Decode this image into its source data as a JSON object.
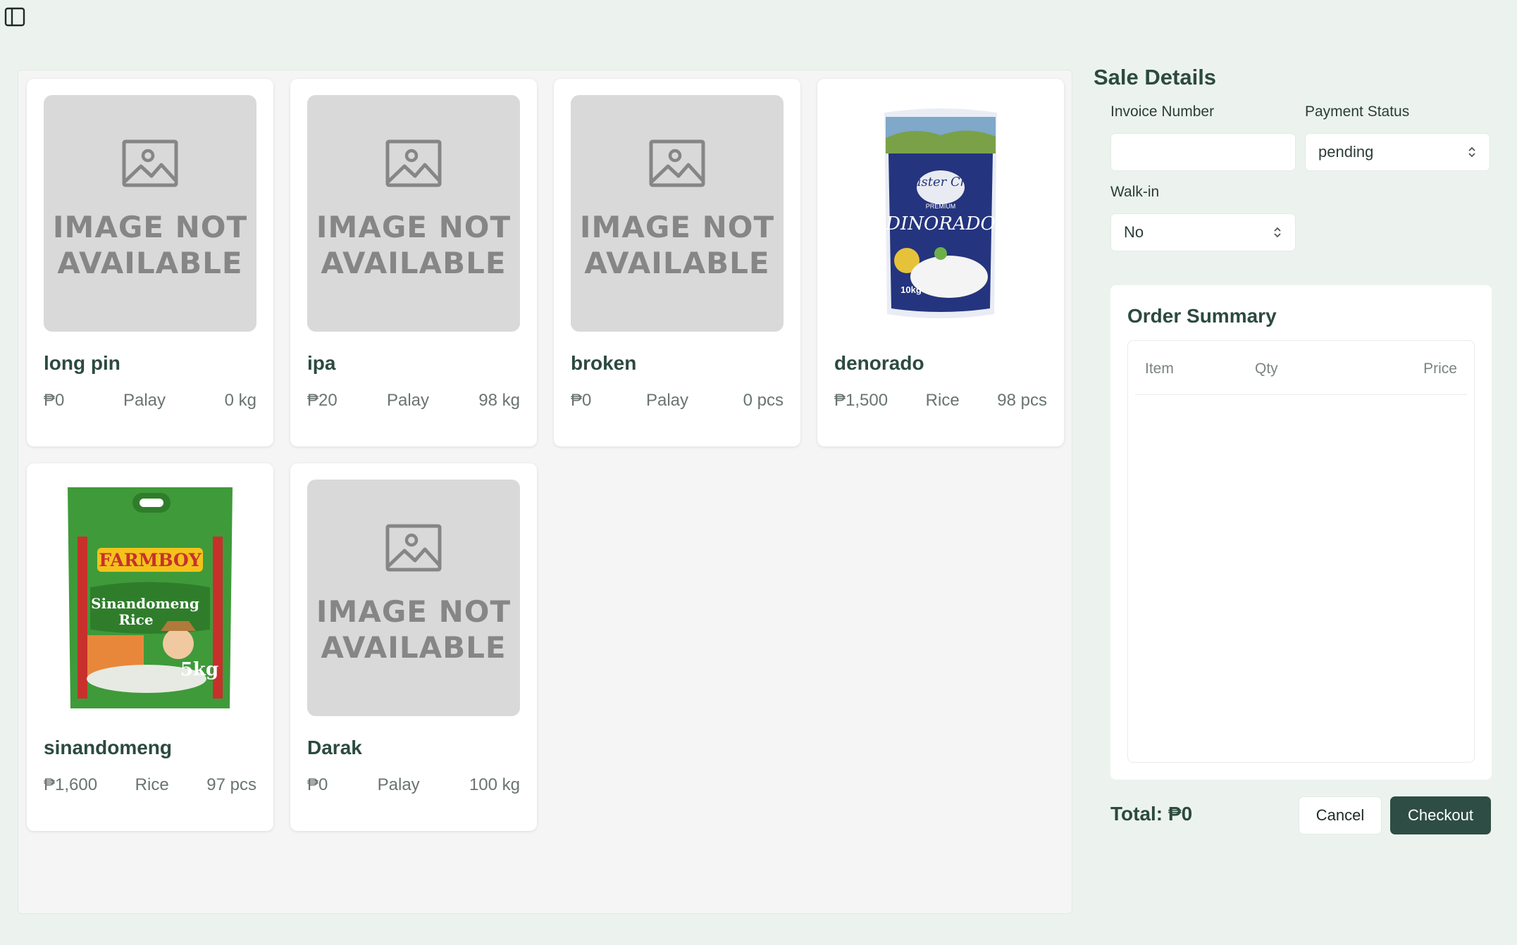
{
  "icons": {
    "sidebar_toggle": "sidebar-toggle-icon",
    "placeholder": "image-placeholder-icon",
    "select_chevrons": "chevron-up-down-icon"
  },
  "placeholder_text": "IMAGE NOT AVAILABLE",
  "products": [
    {
      "name": "long pin",
      "price": "₱0",
      "category": "Palay",
      "stock": "0 kg",
      "image": "placeholder"
    },
    {
      "name": "ipa",
      "price": "₱20",
      "category": "Palay",
      "stock": "98 kg",
      "image": "placeholder"
    },
    {
      "name": "broken",
      "price": "₱0",
      "category": "Palay",
      "stock": "0 pcs",
      "image": "placeholder"
    },
    {
      "name": "denorado",
      "price": "₱1,500",
      "category": "Rice",
      "stock": "98 pcs",
      "image": "masterchef-bag",
      "image_text": [
        "Master Chef",
        "PREMIUM",
        "DINORADO",
        "10kg"
      ]
    },
    {
      "name": "sinandomeng",
      "price": "₱1,600",
      "category": "Rice",
      "stock": "97 pcs",
      "image": "farmboy-bag",
      "image_text": [
        "FARMBOY",
        "Sinandomeng Rice",
        "5kg"
      ]
    },
    {
      "name": "Darak",
      "price": "₱0",
      "category": "Palay",
      "stock": "100 kg",
      "image": "placeholder"
    }
  ],
  "sale": {
    "title": "Sale Details",
    "invoice_label": "Invoice Number",
    "invoice_value": "",
    "payment_label": "Payment Status",
    "payment_value": "pending",
    "walkin_label": "Walk-in",
    "walkin_value": "No"
  },
  "summary": {
    "title": "Order Summary",
    "columns": [
      "Item",
      "Qty",
      "Price"
    ],
    "rows": []
  },
  "total_label": "Total: ₱0",
  "buttons": {
    "cancel": "Cancel",
    "checkout": "Checkout"
  },
  "colors": {
    "background": "#ecf3ef",
    "primary": "#2e4d44",
    "heading": "#2c4a40",
    "placeholder_bg": "#d9d9d9",
    "placeholder_fg": "#868686"
  }
}
